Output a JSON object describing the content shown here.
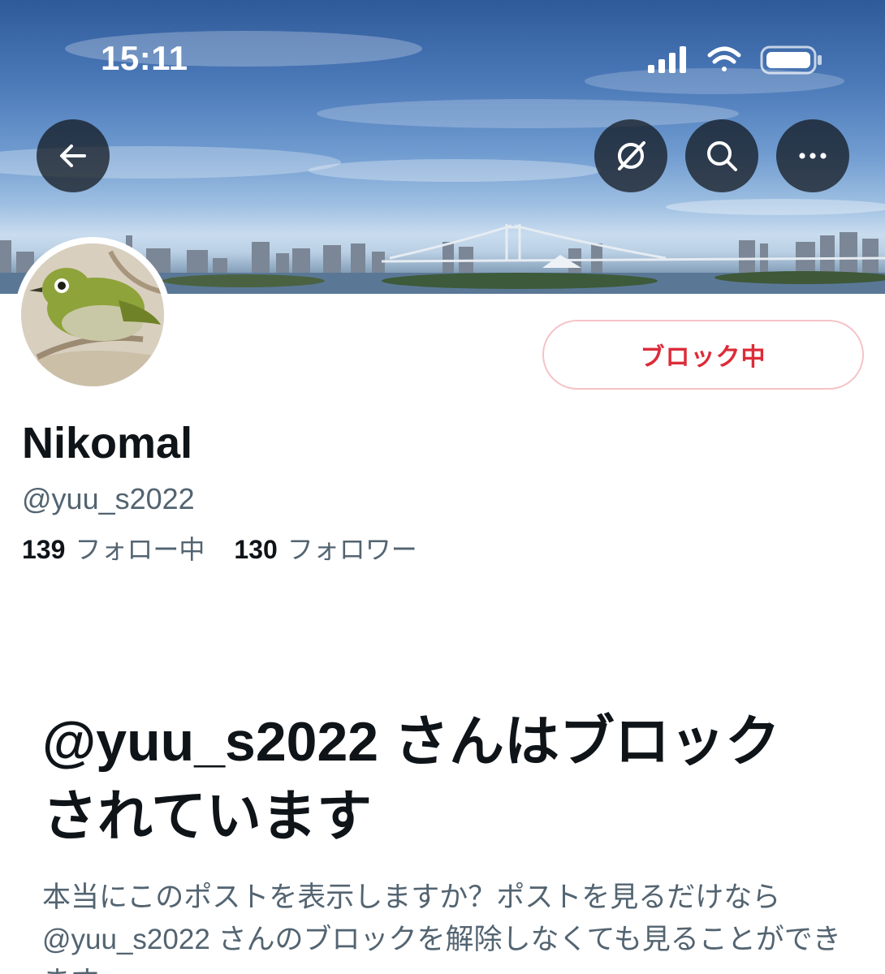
{
  "status_bar": {
    "time": "15:11",
    "icons": [
      "cellular-signal-icon",
      "wifi-icon",
      "battery-icon"
    ]
  },
  "header": {
    "buttons": [
      {
        "name": "back",
        "icon": "arrow-left-icon"
      },
      {
        "name": "grok",
        "icon": "grok-icon"
      },
      {
        "name": "search",
        "icon": "search-icon"
      },
      {
        "name": "more",
        "icon": "more-dots-icon"
      }
    ]
  },
  "profile": {
    "display_name": "Nikomal",
    "handle": "@yuu_s2022",
    "block_button_label": "ブロック中",
    "following_count": "139",
    "following_label": "フォロー中",
    "followers_count": "130",
    "followers_label": "フォロワー"
  },
  "blocked_notice": {
    "title": "@yuu_s2022 さんはブロックされています",
    "description": "本当にこのポストを表示しますか？ポストを見るだけなら @yuu_s2022 さんのブロックを解除しなくても見ることができます。"
  },
  "colors": {
    "accent_red": "#dc2c39",
    "secondary_text": "#536471",
    "primary_text": "#0f1419",
    "button_bg": "#0f1419"
  }
}
